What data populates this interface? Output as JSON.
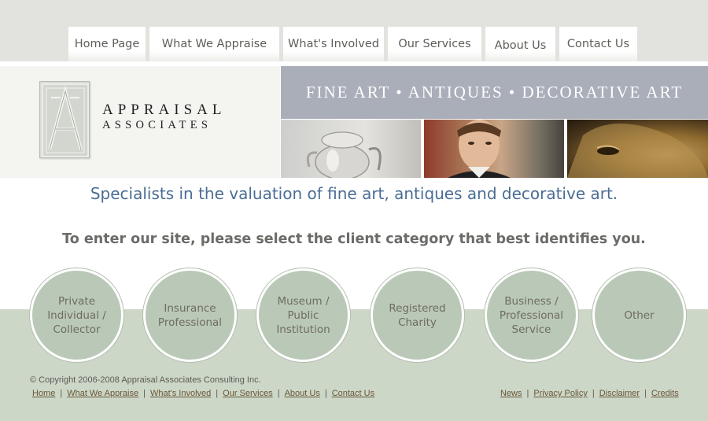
{
  "nav": {
    "tabs": [
      {
        "label": "Home Page"
      },
      {
        "label": "What We Appraise"
      },
      {
        "label": "What's Involved"
      },
      {
        "label": "Our Services"
      },
      {
        "label": "About Us"
      },
      {
        "label": "Contact Us"
      }
    ]
  },
  "logo": {
    "line1": "APPRAISAL",
    "line2": "ASSOCIATES"
  },
  "banner": {
    "tagline": "FINE ART • ANTIQUES • DECORATIVE ART"
  },
  "main": {
    "headline": "Specialists in the valuation of fine art, antiques and decorative art.",
    "prompt": "To enter our site, please select the client category that best identifies you."
  },
  "categories": [
    {
      "lines": [
        "Private",
        "Individual /",
        "Collector"
      ]
    },
    {
      "lines": [
        "Insurance",
        "Professional"
      ]
    },
    {
      "lines": [
        "Museum /",
        "Public",
        "Institution"
      ]
    },
    {
      "lines": [
        "Registered",
        "Charity"
      ]
    },
    {
      "lines": [
        "Business /",
        "Professional",
        "Service"
      ]
    },
    {
      "lines": [
        "Other"
      ]
    }
  ],
  "footer": {
    "copyright": "© Copyright 2006-2008 Appraisal Associates Consulting Inc.",
    "left_links": [
      "Home",
      "What We Appraise",
      "What's Involved",
      "Our Services",
      "About Us",
      "Contact Us"
    ],
    "right_links": [
      "News",
      "Privacy Policy",
      "Disclaimer",
      "Credits"
    ],
    "separator": "|"
  },
  "colors": {
    "top_band": "#e2e3de",
    "banner": "#a9aeb9",
    "headline": "#4a6d94",
    "circle_fill": "#bac9b7",
    "bottom_band": "#ccd7c8"
  }
}
